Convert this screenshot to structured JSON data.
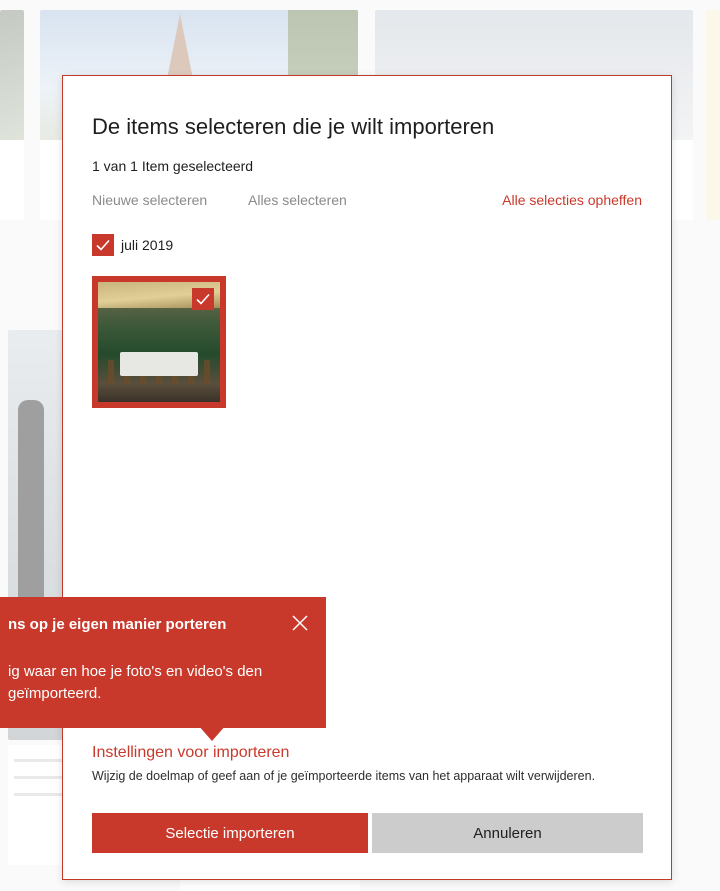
{
  "dialog": {
    "title": "De items selecteren die je wilt importeren",
    "selected_count": "1 van 1 Item geselecteerd",
    "select_new": "Nieuwe selecteren",
    "select_all": "Alles selecteren",
    "clear_selection": "Alle selecties opheffen",
    "group_label": "juli 2019",
    "group_checked": true,
    "item_checked": true,
    "settings_link": "Instellingen voor importeren",
    "settings_desc": "Wijzig de doelmap of geef aan of je geïmporteerde items van het apparaat wilt verwijderen.",
    "import_button": "Selectie importeren",
    "cancel_button": "Annuleren"
  },
  "tip": {
    "title": "ns op je eigen manier porteren",
    "body": "ig waar en hoe je foto's en video's den geïmporteerd."
  },
  "colors": {
    "accent": "#c9392b",
    "cancel_bg": "#cccccc",
    "text": "#1e1e1e"
  },
  "icons": {
    "checkbox": "checkmark-icon",
    "close": "close-icon"
  }
}
